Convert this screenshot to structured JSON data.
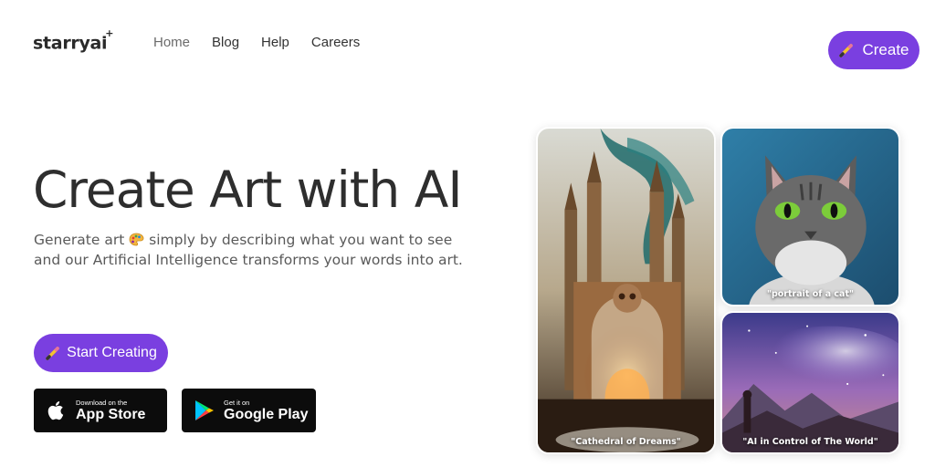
{
  "header": {
    "logo": "starryai",
    "nav": [
      "Home",
      "Blog",
      "Help",
      "Careers"
    ],
    "create_label": "Create"
  },
  "hero": {
    "title": "Create Art with AI",
    "subtitle_part1": "Generate art",
    "subtitle_part2": "simply by describing what you want to see and our Artificial Intelligence transforms your words into art.",
    "start_label": "Start Creating"
  },
  "stores": {
    "apple": {
      "small": "Download on the",
      "big": "App Store"
    },
    "google": {
      "small": "Get it on",
      "big": "Google Play"
    }
  },
  "gallery": [
    {
      "caption": "\"Cathedral of Dreams\""
    },
    {
      "caption": "\"portrait of a cat\""
    },
    {
      "caption": "\"AI in Control of The World\""
    }
  ],
  "colors": {
    "accent": "#7a3fe0",
    "store_bg": "#0c0c0c"
  }
}
